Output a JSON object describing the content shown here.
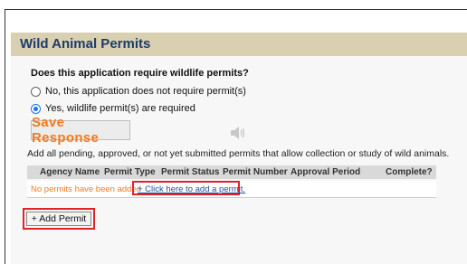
{
  "section": {
    "title": "Wild Animal Permits"
  },
  "question": {
    "text": "Does this application require wildlife permits?"
  },
  "options": [
    {
      "label": "No, this application does not require permit(s)",
      "selected": false
    },
    {
      "label": "Yes, wildlife permit(s) are required",
      "selected": true
    }
  ],
  "save_button": {
    "label": "Save Response",
    "color": "#f27a1e"
  },
  "instructions": "Add all pending, approved, or not yet submitted permits that allow collection or study of wild animals.",
  "table": {
    "columns": [
      "Agency Name",
      "Permit Type",
      "Permit Status",
      "Permit Number",
      "Approval Period",
      "Complete?"
    ],
    "empty_message": "No permits have been added",
    "add_link": "+ Click here to add a permit."
  },
  "add_permit_button": {
    "label": "+ Add Permit"
  },
  "icons": {
    "speaker": "speaker-icon"
  },
  "colors": {
    "header_bg": "#d8d0b0",
    "title": "#1f3b6b",
    "highlight": "#e0232a",
    "link": "#1a4fa3"
  }
}
